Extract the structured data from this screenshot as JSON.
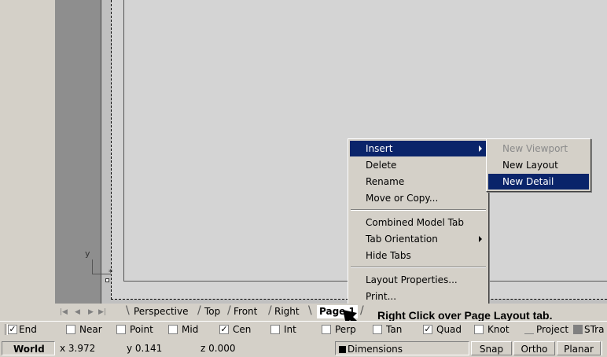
{
  "viewport": {
    "axis_label": "y"
  },
  "context_menu": {
    "items": [
      {
        "label": "Insert",
        "submenu": true,
        "selected": true
      },
      {
        "label": "Delete"
      },
      {
        "label": "Rename"
      },
      {
        "label": "Move or Copy..."
      },
      {
        "label": "Combined Model Tab"
      },
      {
        "label": "Tab Orientation",
        "submenu": true
      },
      {
        "label": "Hide Tabs"
      },
      {
        "label": "Layout Properties..."
      },
      {
        "label": "Print..."
      }
    ]
  },
  "submenu": {
    "items": [
      {
        "label": "New Viewport",
        "disabled": true
      },
      {
        "label": "New Layout"
      },
      {
        "label": "New Detail",
        "selected": true
      }
    ]
  },
  "tabs": {
    "nav_icons": [
      "first-tab-icon",
      "prev-tab-icon",
      "next-tab-icon",
      "last-tab-icon"
    ],
    "items": [
      "Perspective",
      "Top",
      "Front",
      "Right",
      "Page 1"
    ],
    "active": "Page 1"
  },
  "annotation": "Right Click over Page Layout tab.",
  "osnaps": [
    {
      "label": "End",
      "checked": true
    },
    {
      "label": "Near",
      "checked": false
    },
    {
      "label": "Point",
      "checked": false
    },
    {
      "label": "Mid",
      "checked": false
    },
    {
      "label": "Cen",
      "checked": true
    },
    {
      "label": "Int",
      "checked": false
    },
    {
      "label": "Perp",
      "checked": false
    },
    {
      "label": "Tan",
      "checked": false
    },
    {
      "label": "Quad",
      "checked": true
    },
    {
      "label": "Knot",
      "checked": false
    },
    {
      "label": "Project",
      "checked": false
    },
    {
      "label": "STra",
      "checked": false
    }
  ],
  "status": {
    "cplane": "World",
    "x": "x 3.972",
    "y": "y 0.141",
    "z": "z 0.000",
    "layer": "Dimensions",
    "layer_color": "#000000",
    "snap": "Snap",
    "ortho": "Ortho",
    "planar": "Planar"
  },
  "colors": {
    "selection": "#0a246a",
    "chrome": "#d4d0c8"
  }
}
